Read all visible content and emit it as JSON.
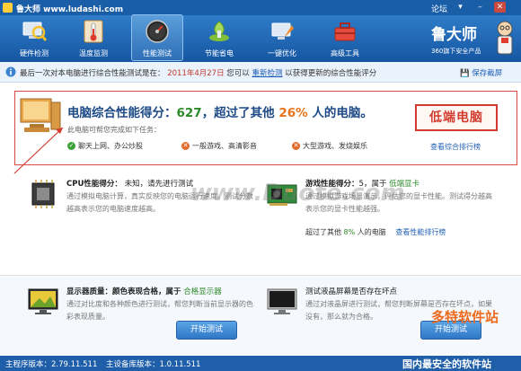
{
  "window": {
    "title": "鲁大师 www.ludashi.com",
    "forum": "论坛"
  },
  "toolbar": {
    "items": [
      {
        "label": "硬件检测",
        "icon": "magnifier-computer-icon"
      },
      {
        "label": "温度监测",
        "icon": "thermometer-icon"
      },
      {
        "label": "性能测试",
        "icon": "speedometer-icon",
        "active": true
      },
      {
        "label": "节能省电",
        "icon": "energy-saving-icon"
      },
      {
        "label": "一键优化",
        "icon": "rocket-optimize-icon"
      },
      {
        "label": "高级工具",
        "icon": "toolbox-icon"
      }
    ],
    "brand": "鲁大师",
    "brand_sub": "360旗下安全产品"
  },
  "infobar": {
    "prefix": "最后一次对本电脑进行综合性能测试是在：",
    "date": "2011年4月27日",
    "middle": "您可以",
    "retest": "重新检测",
    "suffix": "以获得更新的综合性能评分",
    "save": "保存截屏"
  },
  "score": {
    "headline_prefix": "电脑综合性能得分：",
    "score": "627",
    "headline_mid": "，超过了其他",
    "percent": "26%",
    "headline_suffix": "人的电脑。",
    "sub": "此电脑可帮您完成如下任务：",
    "tasks": [
      {
        "label": "聊天上网、办公炒股",
        "ok": true
      },
      {
        "label": "一般游戏、高清影音",
        "ok": false
      },
      {
        "label": "大型游戏、发烧娱乐",
        "ok": false
      }
    ],
    "rank_link": "查看综合排行榜",
    "stamp": "低端电脑"
  },
  "cpu": {
    "title": "CPU性能得分：",
    "value": "未知，请先进行测试",
    "desc": "通过模拟电脑计算，真实反映您的电脑运行速度。测试分数越高表示您的电脑速度越高。"
  },
  "game": {
    "title": "游戏性能得分：",
    "score": "5",
    "mid": "，属于",
    "level": "低端显卡",
    "desc": "通过模拟游戏场景演示，评估您的显卡性能。测试得分越高表示您的显卡性能越强。",
    "beat_prefix": "超过了其他",
    "beat_pct": "8%",
    "beat_suffix": "人的电脑",
    "rank_link": "查看性能排行榜"
  },
  "display": {
    "title": "显示器质量：颜色表现合格，属于",
    "level": "合格显示器",
    "desc": "通过对比度和各种颜色进行测试，帮您判断当前显示器的色彩表现质量。",
    "button": "开始测试"
  },
  "lcd": {
    "title": "测试液晶屏幕是否存在坏点",
    "desc": "通过对液晶屏进行测试，帮您判断屏幕是否存在坏点，如果没有，那么就为合格。",
    "button": "开始测试"
  },
  "watermarks": {
    "center": "www.Duote.com",
    "corner": "多特软件站",
    "corner_sub": "国内最安全的软件站"
  },
  "status": {
    "main_version": "主程序版本：2.79.11.511",
    "db_version": "主设备库版本：1.0.11.511"
  }
}
